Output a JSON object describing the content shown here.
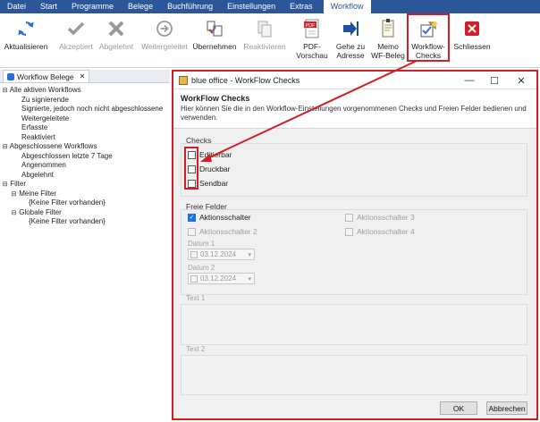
{
  "menu": {
    "tabs": [
      "Datei",
      "Start",
      "Programme",
      "Belege",
      "Buchführung",
      "Einstellungen",
      "Extras"
    ],
    "active_tab": "Workflow"
  },
  "ribbon": {
    "aktualisieren": "Aktualisieren",
    "akzeptiert": "Akzeptiert",
    "abgelehnt": "Abgelehnt",
    "weitergeleitet": "Weitergeleitet",
    "uebernehmen": "Übernehmen",
    "reaktivieren": "Reaktivieren",
    "pdf_line1": "PDF-",
    "pdf_line2": "Vorschau",
    "gehe_line1": "Gehe zu",
    "gehe_line2": "Adresse",
    "memo_line1": "Memo",
    "memo_line2": "WF-Beleg",
    "checks_line1": "Workflow-",
    "checks_line2": "Checks",
    "schliessen": "Schliessen",
    "pdf_badge": "PDF"
  },
  "left_panel": {
    "tab_label": "Workflow Belege",
    "tab_close": "✕",
    "tree": {
      "aktive": "Alle aktiven Workflows",
      "zu_signierende": "Zu signierende",
      "signierte": "Signierte, jedoch noch nicht abgeschlossene",
      "weitergeleitete": "Weitergeleitete",
      "erfasste": "Erfasste",
      "reaktiviert": "Reaktiviert",
      "abgeschlossene": "Abgeschlossene Workflows",
      "abgeschlossen7": "Abgeschlossen letzte 7 Tage",
      "angenommen": "Angenommen",
      "abgelehnt": "Abgelehnt",
      "filter": "Filter",
      "meine_filter": "Meine Filter",
      "keine1": "{Keine Filter vorhanden}",
      "globale_filter": "Globale Filter",
      "keine2": "{Keine Filter vorhanden}"
    }
  },
  "dialog": {
    "title": "blue office - WorkFlow Checks",
    "heading": "WorkFlow Checks",
    "description": "Hier können Sie die in den Workflow-Einstellungen vorgenommenen Checks und Freien Felder bedienen und verwenden.",
    "checks_label": "Checks",
    "checks": [
      "Editierbar",
      "Druckbar",
      "Sendbar"
    ],
    "freie_felder_label": "Freie Felder",
    "aktionsschalter_1": "Aktionsschalter",
    "aktionsschalter_2": "Aktionsschalter 2",
    "aktionsschalter_3": "Aktionsschalter 3",
    "aktionsschalter_4": "Aktionsschalter 4",
    "datum1_label": "Datum 1",
    "datum1_value": "03.12.2024",
    "datum2_label": "Datum 2",
    "datum2_value": "03.12.2024",
    "text1_label": "Text 1",
    "text2_label": "Text 2",
    "ok": "OK",
    "cancel": "Abbrechen"
  },
  "colors": {
    "menubar": "#2b579a",
    "highlight": "#d21f26",
    "checked": "#1a73e8"
  }
}
